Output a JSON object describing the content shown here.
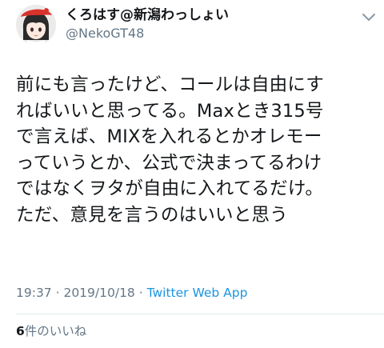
{
  "header": {
    "display_name": "くろはす@新潟わっしょい",
    "handle": "@NekoGT48",
    "avatar_icon": "avatar-illustration",
    "menu_icon": "chevron-down-icon"
  },
  "tweet": {
    "lines": [
      "前にも言ったけど、コールは自由にす",
      "ればいいと思ってる。Maxとき315号",
      "で言えば、MIXを入れるとかオレモー",
      "っていうとか、公式で決まってるわけ",
      "ではなくヲタが自由に入れてるだけ。",
      "ただ、意見を言うのはいいと思う"
    ]
  },
  "meta": {
    "time": "19:37",
    "sep1": " · ",
    "date": "2019/10/18",
    "sep2": " · ",
    "app": "Twitter Web App"
  },
  "stats": {
    "likes_count": "6",
    "likes_label": "件のいいね"
  },
  "colors": {
    "text": "#14171a",
    "secondary": "#657786",
    "link": "#1b95e0",
    "divider": "#e6ecf0"
  }
}
